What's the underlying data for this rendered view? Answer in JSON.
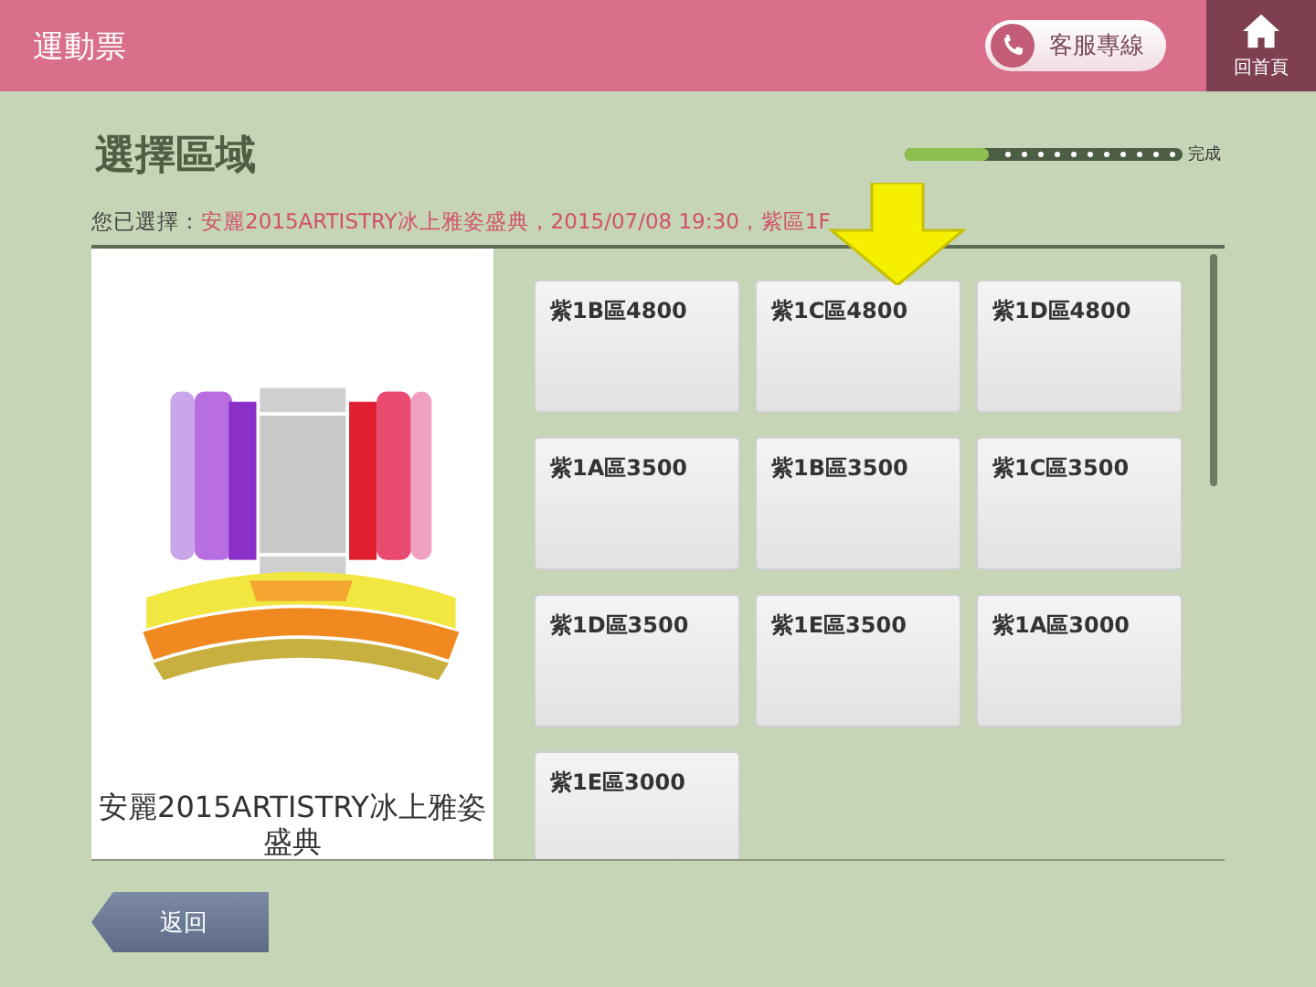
{
  "header": {
    "title": "運動票",
    "hotline_button": "客服專線",
    "home_button": "回首頁"
  },
  "page": {
    "title": "選擇區域",
    "progress": {
      "level": 0.3,
      "label": "完成"
    },
    "selection": {
      "label": "您已選擇：",
      "value": "安麗2015ARTISTRY冰上雅姿盛典，2015/07/08 19:30，紫區1F"
    }
  },
  "seat_map": {
    "kind": "picture",
    "caption": "安麗2015ARTISTRY冰上雅姿盛典"
  },
  "sections": [
    {
      "label": "紫1B區4800",
      "pointed": false
    },
    {
      "label": "紫1C區4800",
      "pointed": true
    },
    {
      "label": "紫1D區4800",
      "pointed": false
    },
    {
      "label": "紫1A區3500",
      "pointed": false
    },
    {
      "label": "紫1B區3500",
      "pointed": false
    },
    {
      "label": "紫1C區3500",
      "pointed": false
    },
    {
      "label": "紫1D區3500",
      "pointed": false
    },
    {
      "label": "紫1E區3500",
      "pointed": false
    },
    {
      "label": "紫1A區3000",
      "pointed": false
    },
    {
      "label": "紫1E區3000",
      "pointed": false
    }
  ],
  "back_button": "返回"
}
